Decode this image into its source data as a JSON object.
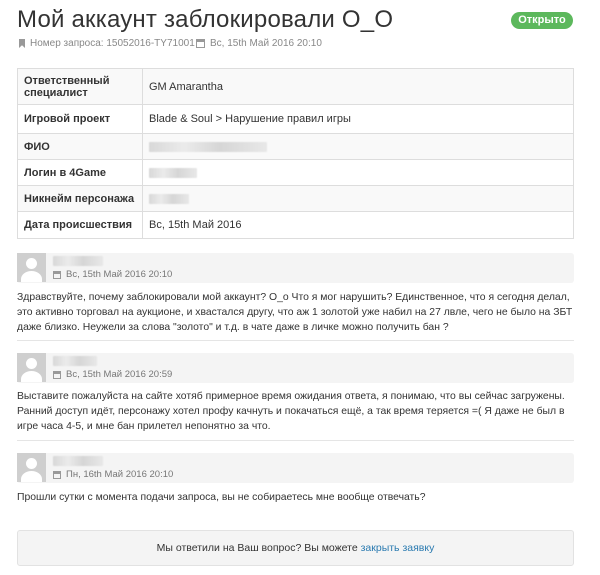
{
  "ticket": {
    "title": "Мой аккаунт заблокировали О_О",
    "status": "Открыто",
    "status_color": "#5cb85c",
    "request_label": "Номер запроса: 15052016-TY71001",
    "date": "Вс, 15th Май 2016 20:10"
  },
  "info": [
    {
      "key": "Ответственный специалист",
      "value": "GM Amarantha"
    },
    {
      "key": "Игровой проект",
      "value": "Blade & Soul > Нарушение правил игры"
    },
    {
      "key": "ФИО",
      "value": ""
    },
    {
      "key": "Логин в 4Game",
      "value": ""
    },
    {
      "key": "Никнейм персонажа",
      "value": ""
    },
    {
      "key": "Дата происшествия",
      "value": "Вс, 15th Май 2016"
    }
  ],
  "posts": [
    {
      "date": "Вс, 15th Май 2016 20:10",
      "text": "Здравствуйте, почему заблокировали мой аккаунт? О_о Что я мог нарушить? Единственное, что я сегодня делал, это активно торговал на аукционе, и хвастался другу, что аж 1 золотой уже набил на 27 лвле, чего не было на ЗБТ даже близко. Неужели за слова \"золото\" и т.д. в чате даже в личке можно получить бан ?"
    },
    {
      "date": "Вс, 15th Май 2016 20:59",
      "text": "Выставите пожалуйста на сайте хотяб примерное время ожидания ответа, я понимаю, что вы сейчас загружены. Ранний доступ идёт, персонажу хотел профу качнуть и покачаться ещё, а так время теряется =( Я даже не был в игре часа 4-5, и мне бан прилетел непонятно за что."
    },
    {
      "date": "Пн, 16th Май 2016 20:10",
      "text": "Прошли сутки с момента подачи запроса, вы не собираетесь мне вообще отвечать?"
    }
  ],
  "footer": {
    "question": "Мы ответили на Ваш вопрос? Вы можете",
    "close_link": "закрыть заявку",
    "link_color": "#2a7ab0"
  }
}
